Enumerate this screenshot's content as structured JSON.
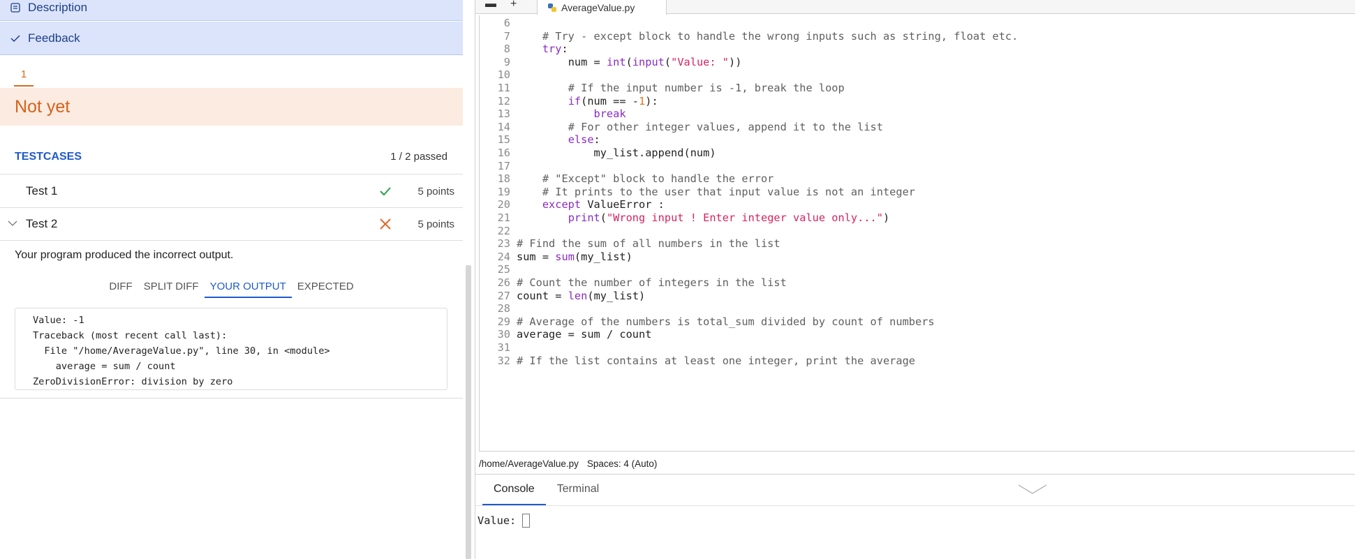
{
  "left_panel": {
    "description_label": "Description",
    "feedback_label": "Feedback",
    "attempt_tab": "1",
    "status": "Not yet",
    "testcases_title": "TESTCASES",
    "passed_summary": "1 / 2 passed",
    "tests": [
      {
        "name": "Test 1",
        "result": "pass",
        "points": "5 points"
      },
      {
        "name": "Test 2",
        "result": "fail",
        "points": "5 points"
      }
    ],
    "result_message": "Your program produced the incorrect output.",
    "output_tabs": [
      "DIFF",
      "SPLIT DIFF",
      "YOUR OUTPUT",
      "EXPECTED"
    ],
    "active_output_tab": "YOUR OUTPUT",
    "output_lines": [
      "Value: -1",
      "Traceback (most recent call last):",
      "  File \"/home/AverageValue.py\", line 30, in <module>",
      "    average = sum / count",
      "ZeroDivisionError: division by zero"
    ]
  },
  "editor": {
    "file_tab": "AverageValue.py",
    "status_path": "/home/AverageValue.py",
    "status_spaces": "Spaces: 4 (Auto)",
    "lines": [
      {
        "n": "6",
        "code": ""
      },
      {
        "n": "7",
        "code": "    # Try - except block to handle the wrong inputs such as string, float etc."
      },
      {
        "n": "8",
        "code": "    try:"
      },
      {
        "n": "9",
        "code": "        num = int(input(\"Value: \"))"
      },
      {
        "n": "10",
        "code": ""
      },
      {
        "n": "11",
        "code": "        # If the input number is -1, break the loop"
      },
      {
        "n": "12",
        "code": "        if(num == -1):"
      },
      {
        "n": "13",
        "code": "            break"
      },
      {
        "n": "14",
        "code": "        # For other integer values, append it to the list"
      },
      {
        "n": "15",
        "code": "        else:"
      },
      {
        "n": "16",
        "code": "            my_list.append(num)"
      },
      {
        "n": "17",
        "code": ""
      },
      {
        "n": "18",
        "code": "    # \"Except\" block to handle the error"
      },
      {
        "n": "19",
        "code": "    # It prints to the user that input value is not an integer"
      },
      {
        "n": "20",
        "code": "    except ValueError :"
      },
      {
        "n": "21",
        "code": "        print(\"Wrong input ! Enter integer value only...\")"
      },
      {
        "n": "22",
        "code": ""
      },
      {
        "n": "23",
        "code": "# Find the sum of all numbers in the list"
      },
      {
        "n": "24",
        "code": "sum = sum(my_list)"
      },
      {
        "n": "25",
        "code": ""
      },
      {
        "n": "26",
        "code": "# Count the number of integers in the list"
      },
      {
        "n": "27",
        "code": "count = len(my_list)"
      },
      {
        "n": "28",
        "code": ""
      },
      {
        "n": "29",
        "code": "# Average of the numbers is total_sum divided by count of numbers"
      },
      {
        "n": "30",
        "code": "average = sum / count"
      },
      {
        "n": "31",
        "code": ""
      },
      {
        "n": "32",
        "code": "# If the list contains at least one integer, print the average"
      }
    ]
  },
  "console": {
    "tabs": [
      "Console",
      "Terminal"
    ],
    "active_tab": "Console",
    "output": "Value:"
  },
  "colors": {
    "accent_blue": "#1f5ac9",
    "status_orange": "#d4621a",
    "pass_green": "#2e9e4b",
    "fail_orange": "#e06a2a"
  }
}
